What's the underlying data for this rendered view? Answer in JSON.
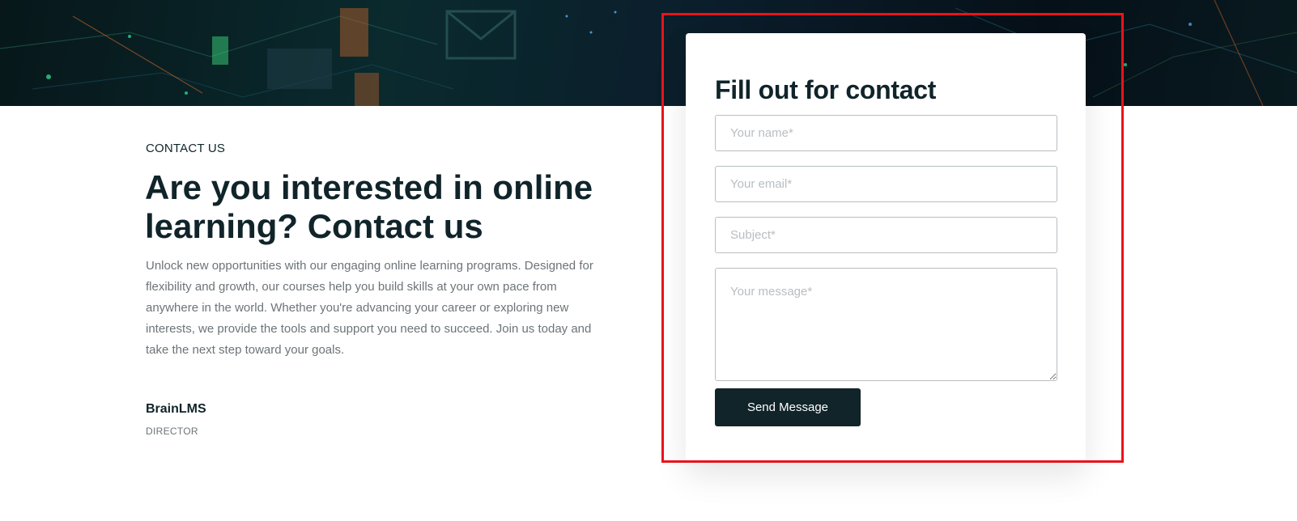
{
  "hero": {
    "icon": "envelope-icon",
    "colors": {
      "dark": "#07171a",
      "accent_green": "#2fd08a",
      "accent_orange": "#c8642a"
    }
  },
  "intro_section": {
    "eyebrow": "CONTACT US",
    "headline": "Are you interested in online learning? Contact us",
    "body": "Unlock new opportunities with our engaging online learning programs. Designed for flexibility and growth, our courses help you build skills at your own pace from anywhere in the world. Whether you're advancing your career or exploring new interests, we provide the tools and support you need to succeed. Join us today and take the next step toward your goals.",
    "signature_name": "BrainLMS",
    "signature_role": "DIRECTOR"
  },
  "contact_form": {
    "title": "Fill out for contact",
    "name_placeholder": "Your name*",
    "email_placeholder": "Your email*",
    "subject_placeholder": "Subject*",
    "message_placeholder": "Your message*",
    "submit_label": "Send Message"
  },
  "colors": {
    "text_dark": "#10242a",
    "text_muted": "#6c7478",
    "button_bg": "#10242a",
    "highlight": "#e8141b"
  }
}
